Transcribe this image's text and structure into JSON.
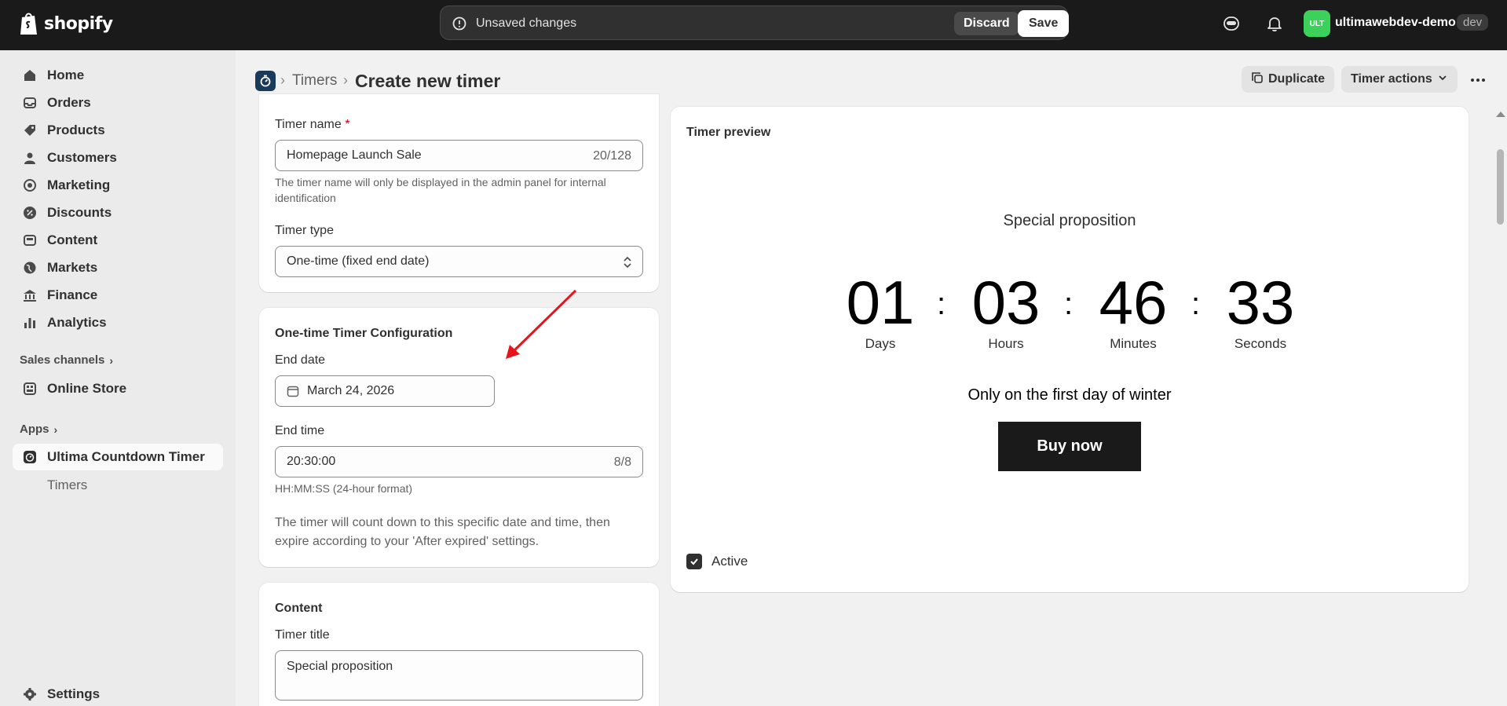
{
  "topbar": {
    "logo_text": "shopify",
    "unsaved_text": "Unsaved changes",
    "discard_label": "Discard",
    "save_label": "Save",
    "store_badge": "ULT",
    "store_name": "ultimawebdev-demo",
    "store_tag": "dev"
  },
  "sidebar": {
    "items": [
      {
        "label": "Home",
        "icon": "home-icon"
      },
      {
        "label": "Orders",
        "icon": "inbox-icon"
      },
      {
        "label": "Products",
        "icon": "tag-icon"
      },
      {
        "label": "Customers",
        "icon": "person-icon"
      },
      {
        "label": "Marketing",
        "icon": "target-icon"
      },
      {
        "label": "Discounts",
        "icon": "discount-icon"
      },
      {
        "label": "Content",
        "icon": "content-icon"
      },
      {
        "label": "Markets",
        "icon": "globe-icon"
      },
      {
        "label": "Finance",
        "icon": "bank-icon"
      },
      {
        "label": "Analytics",
        "icon": "chart-icon"
      }
    ],
    "sales_channels_label": "Sales channels",
    "online_store_label": "Online Store",
    "apps_label": "Apps",
    "app_label": "Ultima Countdown Timer",
    "app_sub_label": "Timers",
    "settings_label": "Settings"
  },
  "header": {
    "breadcrumb_link": "Timers",
    "title": "Create new timer",
    "duplicate_label": "Duplicate",
    "timer_actions_label": "Timer actions"
  },
  "form": {
    "timer_name_label": "Timer name",
    "required_mark": "*",
    "timer_name_value": "Homepage Launch Sale",
    "timer_name_count": "20/128",
    "timer_name_help": "The timer name will only be displayed in the admin panel for internal identification",
    "timer_type_label": "Timer type",
    "timer_type_value": "One-time (fixed end date)",
    "config_title": "One-time Timer Configuration",
    "end_date_label": "End date",
    "end_date_value": "March 24, 2026",
    "end_time_label": "End time",
    "end_time_value": "20:30:00",
    "end_time_count": "8/8",
    "end_time_help": "HH:MM:SS (24-hour format)",
    "config_note": "The timer will count down to this specific date and time, then expire according to your 'After expired' settings.",
    "content_title": "Content",
    "timer_title_label": "Timer title",
    "timer_title_value": "Special proposition"
  },
  "preview": {
    "title": "Timer preview",
    "heading": "Special proposition",
    "days": "01",
    "hours": "03",
    "minutes": "46",
    "seconds": "33",
    "colon": ":",
    "days_label": "Days",
    "hours_label": "Hours",
    "minutes_label": "Minutes",
    "seconds_label": "Seconds",
    "subheading": "Only on the first day of winter",
    "button_label": "Buy now",
    "active_label": "Active",
    "active_checked": true
  },
  "colors": {
    "topbar_bg": "#1a1a1a",
    "store_badge": "#3bd15a",
    "annotation_arrow": "#e8141b",
    "buy_button": "#1a1a1a"
  }
}
